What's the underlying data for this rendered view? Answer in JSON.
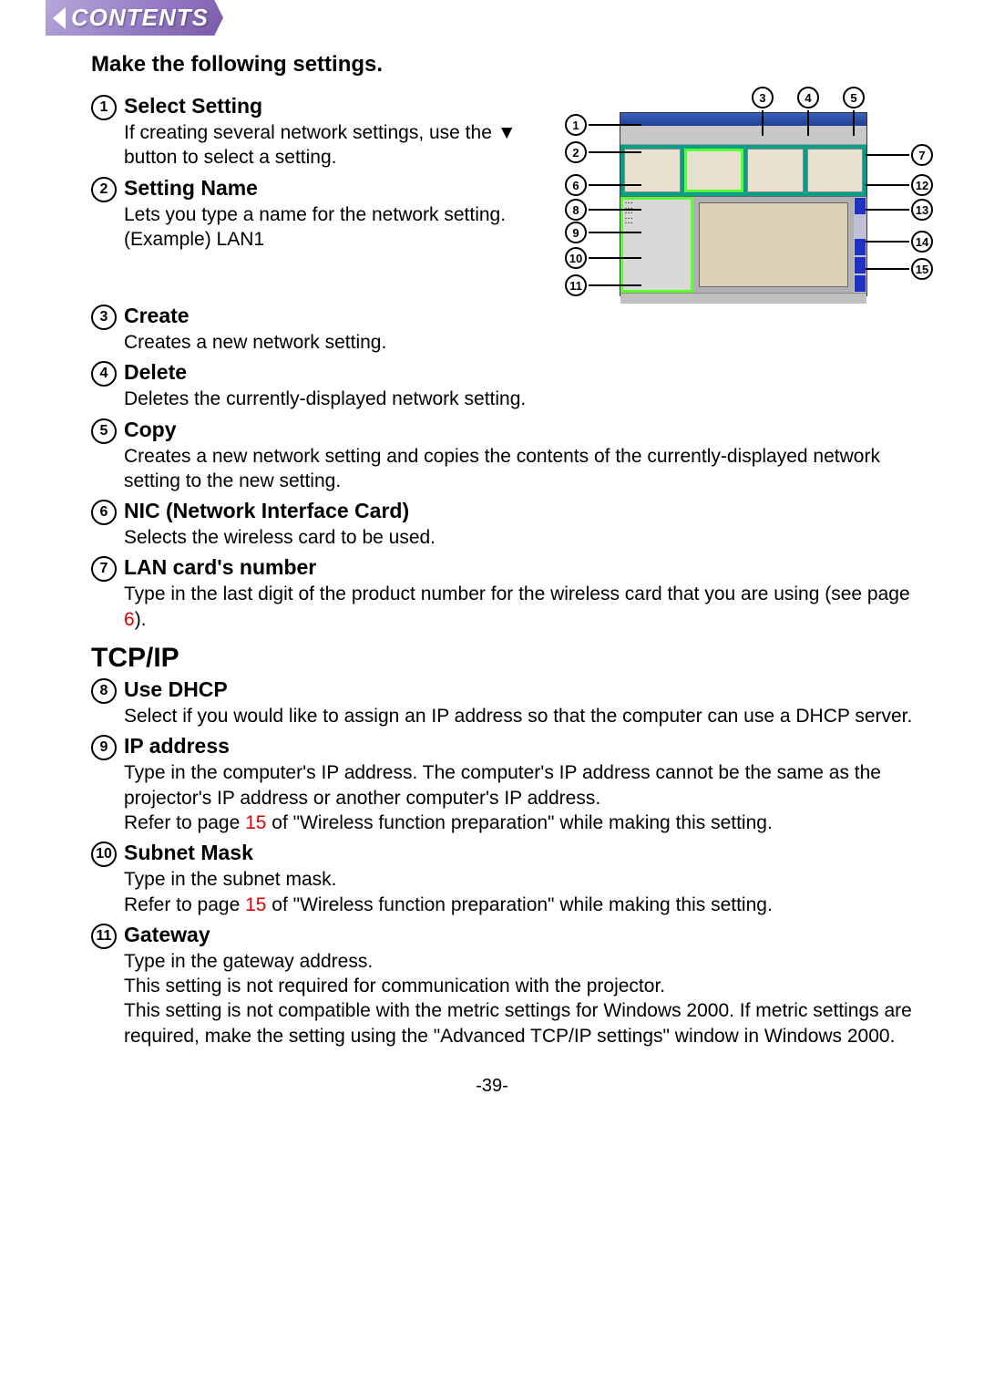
{
  "banner": {
    "label": "CONTENTS"
  },
  "intro": "Make the following settings.",
  "section_tcpip": "TCP/IP",
  "page_number": "-39-",
  "items": [
    {
      "num": "1",
      "title": "Select Setting",
      "desc": "If creating several network settings, use the ▼ button to select a setting."
    },
    {
      "num": "2",
      "title": "Setting Name",
      "desc": "Lets you type a name for the network setting.\n(Example) LAN1"
    },
    {
      "num": "3",
      "title": "Create",
      "desc": "Creates a new network setting."
    },
    {
      "num": "4",
      "title": "Delete",
      "desc": "Deletes the currently-displayed network setting."
    },
    {
      "num": "5",
      "title": "Copy",
      "desc": "Creates a new network setting and copies the contents of the currently-displayed network setting to the new setting."
    },
    {
      "num": "6",
      "title": "NIC (Network Interface Card)",
      "desc": "Selects the wireless card to be used."
    },
    {
      "num": "7",
      "title": "LAN card's number",
      "desc_pre": "Type in the last digit of the product number for the wireless card that you are using (see page ",
      "link": "6",
      "desc_post": ")."
    },
    {
      "num": "8",
      "title": "Use DHCP",
      "desc": "Select if you would like to assign an IP address so that the computer can use a DHCP server."
    },
    {
      "num": "9",
      "title": "IP address",
      "desc_pre": "Type in the computer's IP address. The computer's IP address cannot be the same as the projector's IP address or another computer's IP address.\nRefer to page ",
      "link": "15",
      "desc_post": " of \"Wireless function preparation\" while making this setting."
    },
    {
      "num": "10",
      "title": "Subnet Mask",
      "desc_pre": "Type in the subnet mask.\nRefer to page ",
      "link": "15",
      "desc_post": " of \"Wireless function preparation\" while making this setting."
    },
    {
      "num": "11",
      "title": "Gateway",
      "desc": "Type in the gateway address.\nThis setting is not required for communication with the projector.\nThis setting is not compatible with the metric settings for Windows 2000. If metric settings are required, make the setting using the \"Advanced TCP/IP settings\" window in Windows 2000."
    }
  ],
  "figure": {
    "callouts_top": [
      "3",
      "4",
      "5"
    ],
    "callouts_left": [
      "1",
      "2",
      "6",
      "8",
      "9",
      "10",
      "11"
    ],
    "callouts_right": [
      "7",
      "12",
      "13",
      "14",
      "15"
    ]
  }
}
